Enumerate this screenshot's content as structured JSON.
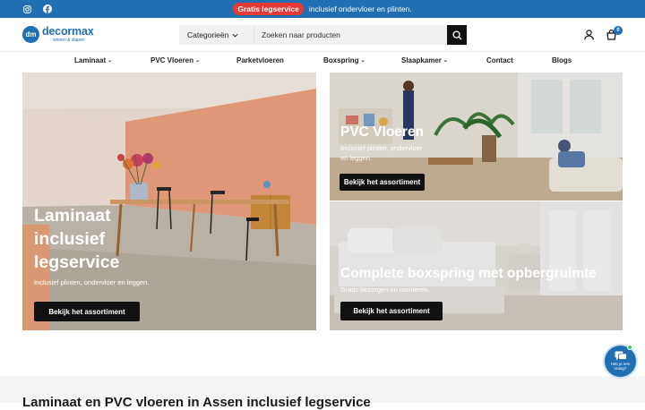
{
  "topbar": {
    "promo_badge": "Gratis legservice",
    "promo_text": "inclusief ondervloer en plinten.",
    "social_icons": [
      "instagram-icon",
      "facebook-icon"
    ]
  },
  "header": {
    "logo_mark": "dm",
    "logo_name": "decormax",
    "logo_tagline": "wonen & slapen",
    "category_select": "Categorieën",
    "search_placeholder": "Zoeken naar producten",
    "cart_count": "0"
  },
  "nav": {
    "items": [
      {
        "label": "Laminaat",
        "dropdown": true
      },
      {
        "label": "PVC Vloeren",
        "dropdown": true
      },
      {
        "label": "Parketvloeren",
        "dropdown": false
      },
      {
        "label": "Boxspring",
        "dropdown": true
      },
      {
        "label": "Slaapkamer",
        "dropdown": true
      },
      {
        "label": "Contact",
        "dropdown": false
      },
      {
        "label": "Blogs",
        "dropdown": false
      }
    ]
  },
  "tiles": {
    "laminaat": {
      "title": "Laminaat inclusief legservice",
      "subtitle": "Inclusief plinten, ondervloer en leggen.",
      "button": "Bekijk het assortiment"
    },
    "pvc": {
      "title": "PVC Vloeren",
      "subtitle": "Inclusief plinten, ondervloer en leggen.",
      "button": "Bekijk het assortiment"
    },
    "boxspring": {
      "title": "Complete boxspring met opbergruimte",
      "subtitle": "Gratis bezorgen en monteren.",
      "button": "Bekijk het assortiment"
    }
  },
  "section": {
    "heading": "Laminaat en PVC vloeren in Assen inclusief legservice"
  },
  "chat": {
    "label": "Heb je een vraag?"
  },
  "colors": {
    "brand": "#1f6fb2",
    "promo_badge": "#e53935",
    "button": "#111111"
  }
}
